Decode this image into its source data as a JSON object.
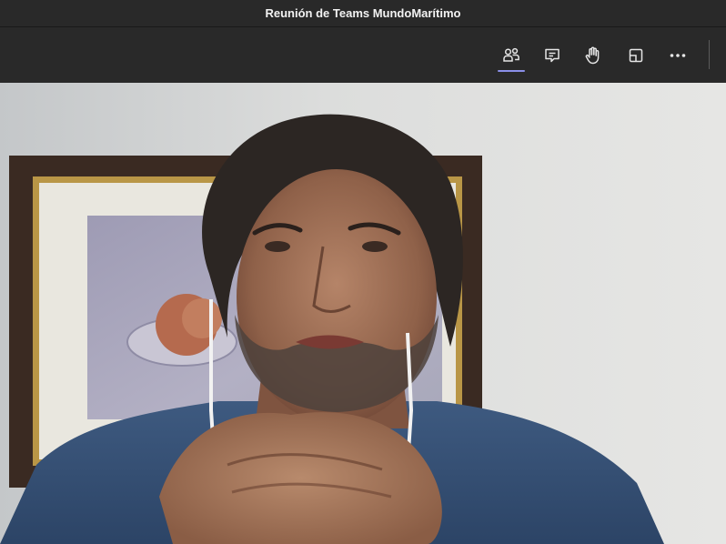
{
  "window": {
    "title": "Reunión de Teams MundoMarítimo"
  },
  "toolbar": {
    "buttons": [
      {
        "name": "participants",
        "icon": "people-icon",
        "active": true
      },
      {
        "name": "chat",
        "icon": "chat-icon",
        "active": false
      },
      {
        "name": "raise-hand",
        "icon": "hand-icon",
        "active": false
      },
      {
        "name": "rooms",
        "icon": "rooms-icon",
        "active": false
      },
      {
        "name": "more-actions",
        "icon": "more-icon",
        "active": false
      }
    ]
  },
  "colors": {
    "chrome_background": "#292929",
    "title_text": "#f2f2f2",
    "icon": "#e6e6e6",
    "active_indicator": "#8a8fe8"
  },
  "video": {
    "content": "participant-video-feed"
  }
}
